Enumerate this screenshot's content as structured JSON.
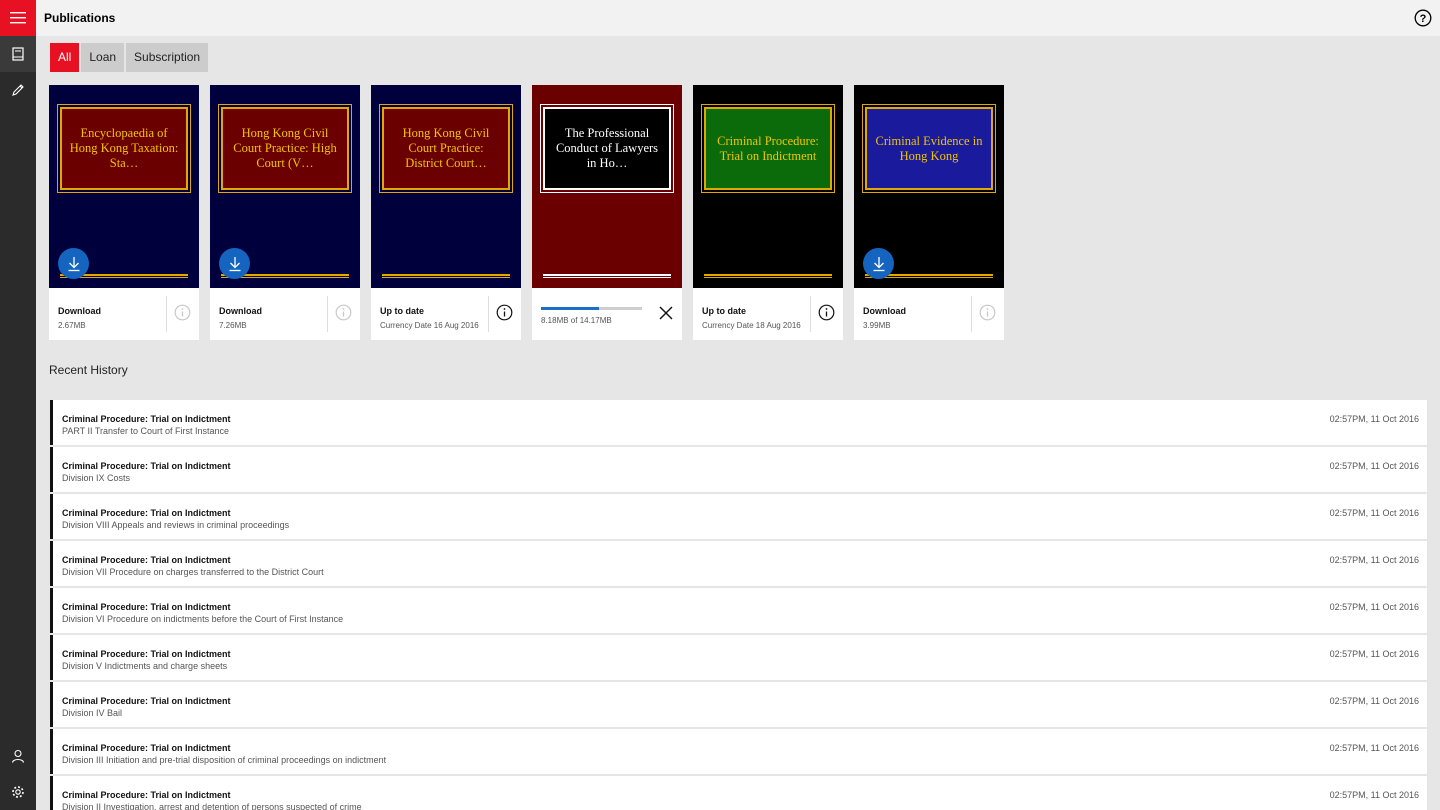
{
  "window": {
    "title": "Publications"
  },
  "tabs": [
    {
      "label": "All",
      "active": true
    },
    {
      "label": "Loan",
      "active": false
    },
    {
      "label": "Subscription",
      "active": false
    }
  ],
  "books": [
    {
      "title": "Encyclopaedia of Hong Kong Taxation: Sta…",
      "cover_bg": "#00003c",
      "plate_bg": "#6b0000",
      "text_color": "#f2c400",
      "status": "Download",
      "detail": "2.67MB",
      "downloadable": true
    },
    {
      "title": "Hong Kong Civil Court Practice: High Court (V…",
      "cover_bg": "#00003c",
      "plate_bg": "#6b0000",
      "text_color": "#f2c400",
      "status": "Download",
      "detail": "7.26MB",
      "downloadable": true
    },
    {
      "title": "Hong Kong Civil Court Practice: District Court…",
      "cover_bg": "#00003c",
      "plate_bg": "#6b0000",
      "text_color": "#f2c400",
      "status": "Up to date",
      "detail": "Currency Date 16 Aug 2016",
      "downloadable": false
    },
    {
      "title": "The Professional Conduct of Lawyers in Ho…",
      "cover_bg": "#6b0000",
      "plate_bg": "#000000",
      "text_color": "#ffffff",
      "status": "",
      "detail": "8.18MB of 14.17MB",
      "downloadable": false,
      "downloading": true,
      "progress": 0.577
    },
    {
      "title": "Criminal Procedure: Trial on Indictment",
      "cover_bg": "#000000",
      "plate_bg": "#0b6b0b",
      "text_color": "#f2c400",
      "status": "Up to date",
      "detail": "Currency Date 18 Aug 2016",
      "downloadable": false
    },
    {
      "title": "Criminal Evidence in Hong Kong",
      "cover_bg": "#000000",
      "plate_bg": "#1a1a9c",
      "text_color": "#f2c400",
      "status": "Download",
      "detail": "3.99MB",
      "downloadable": true
    }
  ],
  "recent": {
    "heading": "Recent History",
    "items": [
      {
        "title": "Criminal Procedure: Trial on Indictment",
        "subtitle": "PART II Transfer to Court of First Instance",
        "time": "02:57PM, 11 Oct 2016"
      },
      {
        "title": "Criminal Procedure: Trial on Indictment",
        "subtitle": "Division IX Costs",
        "time": "02:57PM, 11 Oct 2016"
      },
      {
        "title": "Criminal Procedure: Trial on Indictment",
        "subtitle": "Division VIII Appeals and reviews in criminal proceedings",
        "time": "02:57PM, 11 Oct 2016"
      },
      {
        "title": "Criminal Procedure: Trial on Indictment",
        "subtitle": "Division VII Procedure on charges transferred to the District Court",
        "time": "02:57PM, 11 Oct 2016"
      },
      {
        "title": "Criminal Procedure: Trial on Indictment",
        "subtitle": "Division VI Procedure on indictments before the Court of First Instance",
        "time": "02:57PM, 11 Oct 2016"
      },
      {
        "title": "Criminal Procedure: Trial on Indictment",
        "subtitle": "Division V Indictments and charge sheets",
        "time": "02:57PM, 11 Oct 2016"
      },
      {
        "title": "Criminal Procedure: Trial on Indictment",
        "subtitle": "Division IV Bail",
        "time": "02:57PM, 11 Oct 2016"
      },
      {
        "title": "Criminal Procedure: Trial on Indictment",
        "subtitle": "Division III Initiation and pre-trial disposition of criminal proceedings on indictment",
        "time": "02:57PM, 11 Oct 2016"
      },
      {
        "title": "Criminal Procedure: Trial on Indictment",
        "subtitle": "Division II Investigation, arrest and detention of persons suspected of crime",
        "time": "02:57PM, 11 Oct 2016"
      }
    ]
  },
  "icons": {
    "menu": "hamburger-icon",
    "library": "book-icon",
    "notes": "pencil-icon",
    "account": "person-icon",
    "settings": "gear-icon",
    "help": "help-icon"
  },
  "colors": {
    "accent": "#e81123",
    "rail": "#2b2b2b",
    "download": "#1565c0"
  }
}
